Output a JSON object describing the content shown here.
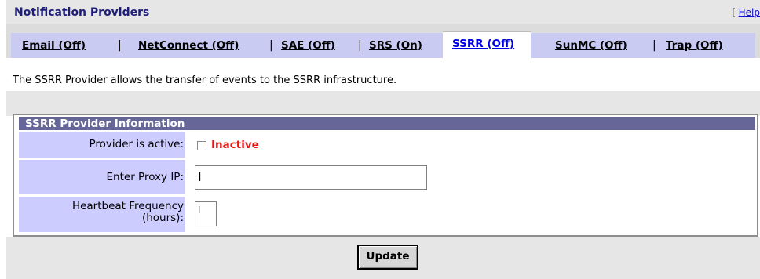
{
  "header": {
    "title": "Notification Providers",
    "help_label": "Help",
    "help_open": "[ ",
    "help_close": " ]"
  },
  "tabs": [
    {
      "label": "Email (Off)"
    },
    {
      "label": "NetConnect (Off)"
    },
    {
      "label": "SAE (Off)"
    },
    {
      "label": "SRS (On)"
    },
    {
      "label": "SSRR (Off)",
      "active": true
    },
    {
      "label": "SunMC (Off)"
    },
    {
      "label": "Trap (Off)"
    }
  ],
  "separator": "|",
  "description": "The SSRR Provider allows the transfer of events to the SSRR infrastructure.",
  "panel": {
    "title": "SSRR Provider Information",
    "active_label": "Provider is active:",
    "active_status": "Inactive",
    "proxy_label": "Enter Proxy IP:",
    "proxy_value": "",
    "heartbeat_label_line1": "Heartbeat Frequency",
    "heartbeat_label_line2": "(hours):",
    "heartbeat_value": ""
  },
  "footer": {
    "update_label": "Update"
  },
  "colors": {
    "header_title": "#1f1f7a",
    "tab_strip": "#c9cbf2",
    "panel_title_bg": "#666699",
    "row_label_bg": "#ccccff",
    "inactive_text": "#e51515"
  }
}
